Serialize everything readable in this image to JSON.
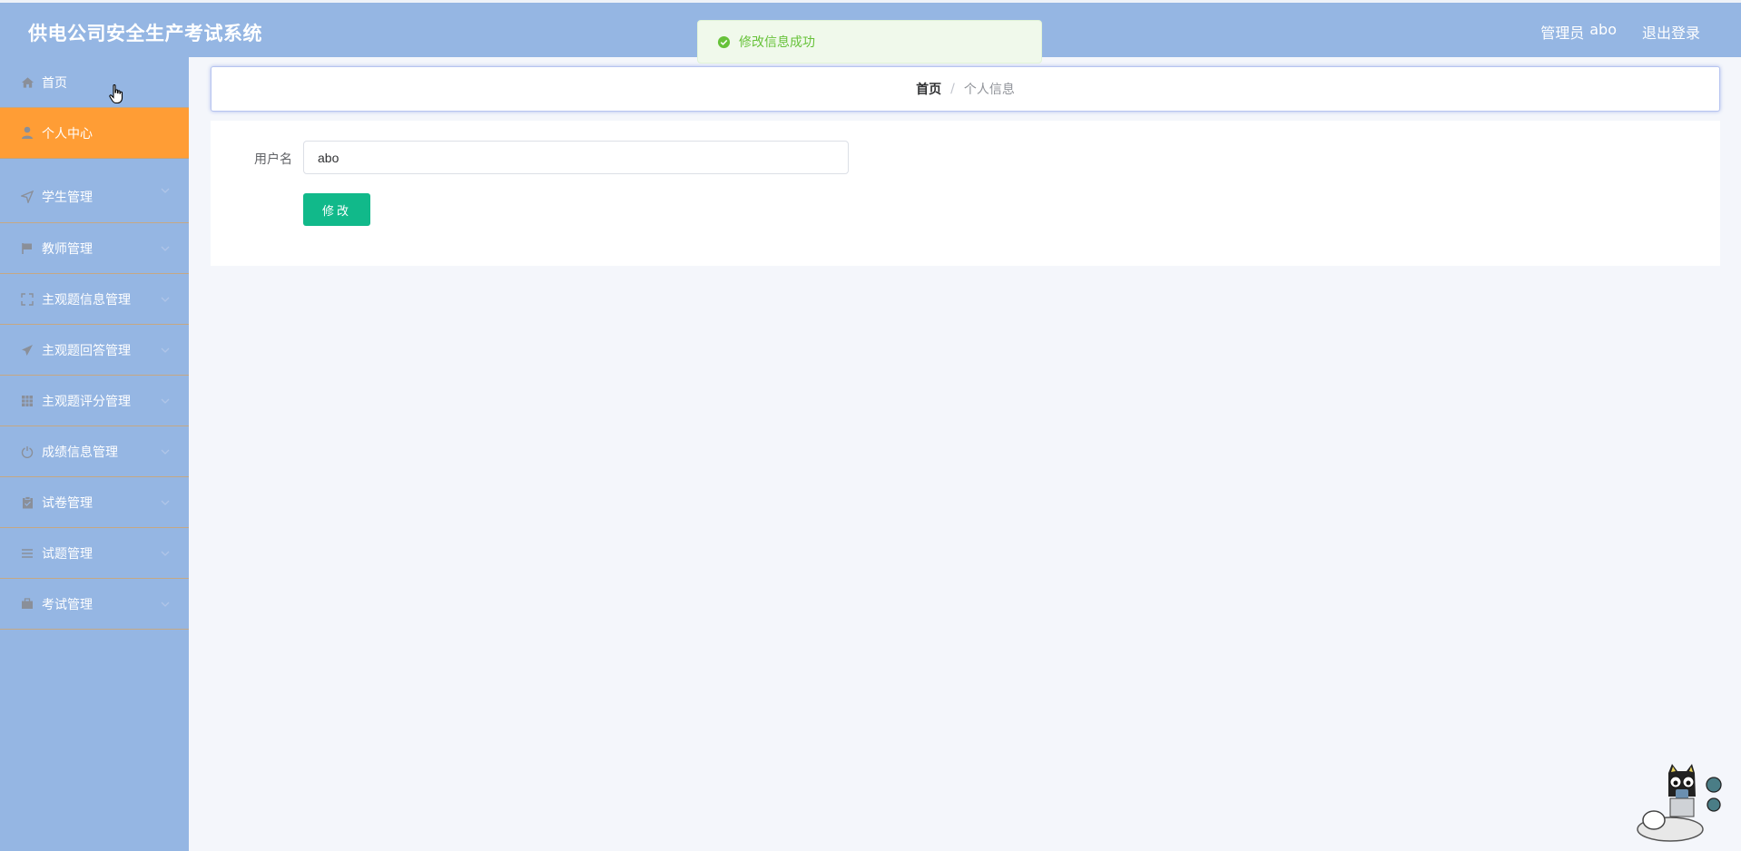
{
  "header": {
    "title": "供电公司安全生产考试系统",
    "role": "管理员",
    "username": "abo",
    "logout_label": "退出登录"
  },
  "sidebar": {
    "items": [
      {
        "label": "首页",
        "icon": "home-icon",
        "active": false,
        "expandable": false
      },
      {
        "label": "个人中心",
        "icon": "user-icon",
        "active": true,
        "expandable": false
      },
      {
        "label": "学生管理",
        "icon": "navigation-arrow-icon",
        "active": false,
        "expandable": true
      },
      {
        "label": "教师管理",
        "icon": "flag-icon",
        "active": false,
        "expandable": true
      },
      {
        "label": "主观题信息管理",
        "icon": "fullscreen-icon",
        "active": false,
        "expandable": true
      },
      {
        "label": "主观题回答管理",
        "icon": "paper-plane-icon",
        "active": false,
        "expandable": true
      },
      {
        "label": "主观题评分管理",
        "icon": "grid-icon",
        "active": false,
        "expandable": true
      },
      {
        "label": "成绩信息管理",
        "icon": "power-icon",
        "active": false,
        "expandable": true
      },
      {
        "label": "试卷管理",
        "icon": "clipboard-icon",
        "active": false,
        "expandable": true
      },
      {
        "label": "试题管理",
        "icon": "list-icon",
        "active": false,
        "expandable": true
      },
      {
        "label": "考试管理",
        "icon": "briefcase-icon",
        "active": false,
        "expandable": true
      }
    ]
  },
  "breadcrumb": {
    "home": "首页",
    "separator": "/",
    "current": "个人信息"
  },
  "form": {
    "username_label": "用户名",
    "username_value": "abo",
    "submit_label": "修改"
  },
  "toast": {
    "message": "修改信息成功",
    "type": "success"
  },
  "colors": {
    "header_bg": "#95b6e3",
    "sidebar_bg": "#95b6e3",
    "active_item": "#ff9d35",
    "submit_button": "#11b98a",
    "toast_text": "#67c23a"
  }
}
